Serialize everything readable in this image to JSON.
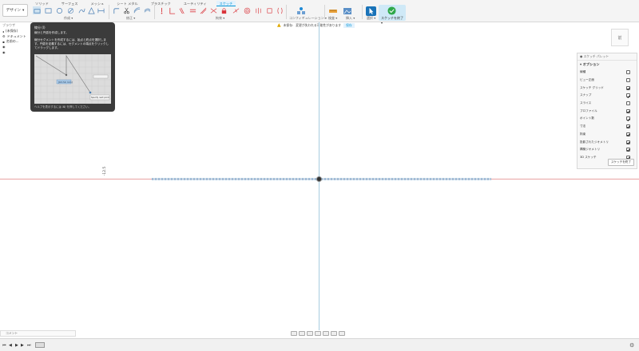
{
  "workspace": {
    "label": "デザイン"
  },
  "tabs": [
    {
      "label": "ソリッド"
    },
    {
      "label": "サーフェス"
    },
    {
      "label": "メッシュ"
    },
    {
      "label": "シート メタル"
    },
    {
      "label": "プラスチック"
    },
    {
      "label": "ユーティリティ"
    },
    {
      "label": "スケッチ",
      "active": true
    }
  ],
  "groups": {
    "create": "作成",
    "modify": "修正",
    "constraints": "拘束",
    "config": "コンフィギュレーション",
    "inspect": "検査",
    "insert": "挿入",
    "select": "選択",
    "finish": "スケッチを終了"
  },
  "warning": {
    "label": "未保存:",
    "text": "変更が失われる可能性があります",
    "button": "保存"
  },
  "viewcube": {
    "face": "前"
  },
  "browser": {
    "header": "ブラウザ",
    "items": [
      "(未保存)",
      "ドキュメント",
      "名前の...",
      "",
      ""
    ]
  },
  "tooltip": {
    "title": "線分 (I)",
    "subtitle": "線分と円弧を作成します。",
    "body": "線分セグメントを作成するには、始点と終点を選択します。円弧を定義するには、セグメントの端点をクリックしてドラッグします。",
    "footer": "ヘルプを表示するには ⌘/ を押してください。",
    "img_dim": "[63.50 mm]",
    "img_tag": "Specify next point"
  },
  "canvas": {
    "dim_text": "-12.5"
  },
  "palette": {
    "header": "スケッチ パレット",
    "section": "オプション",
    "rows": [
      {
        "label": "線種",
        "checked": false
      },
      {
        "label": "ビュー正面",
        "checked": false
      },
      {
        "label": "スケッチ グリッド",
        "checked": true
      },
      {
        "label": "スナップ",
        "checked": true
      },
      {
        "label": "スライス",
        "checked": false
      },
      {
        "label": "プロファイル",
        "checked": true
      },
      {
        "label": "ポイント数",
        "checked": true
      },
      {
        "label": "寸法",
        "checked": true
      },
      {
        "label": "拘束",
        "checked": true
      },
      {
        "label": "投影されたジオメトリ",
        "checked": true
      },
      {
        "label": "構築ジオメトリ",
        "checked": true
      },
      {
        "label": "3D スケッチ",
        "checked": true
      }
    ],
    "stop": "スケッチを終了"
  },
  "comments": {
    "label": "コメント"
  }
}
